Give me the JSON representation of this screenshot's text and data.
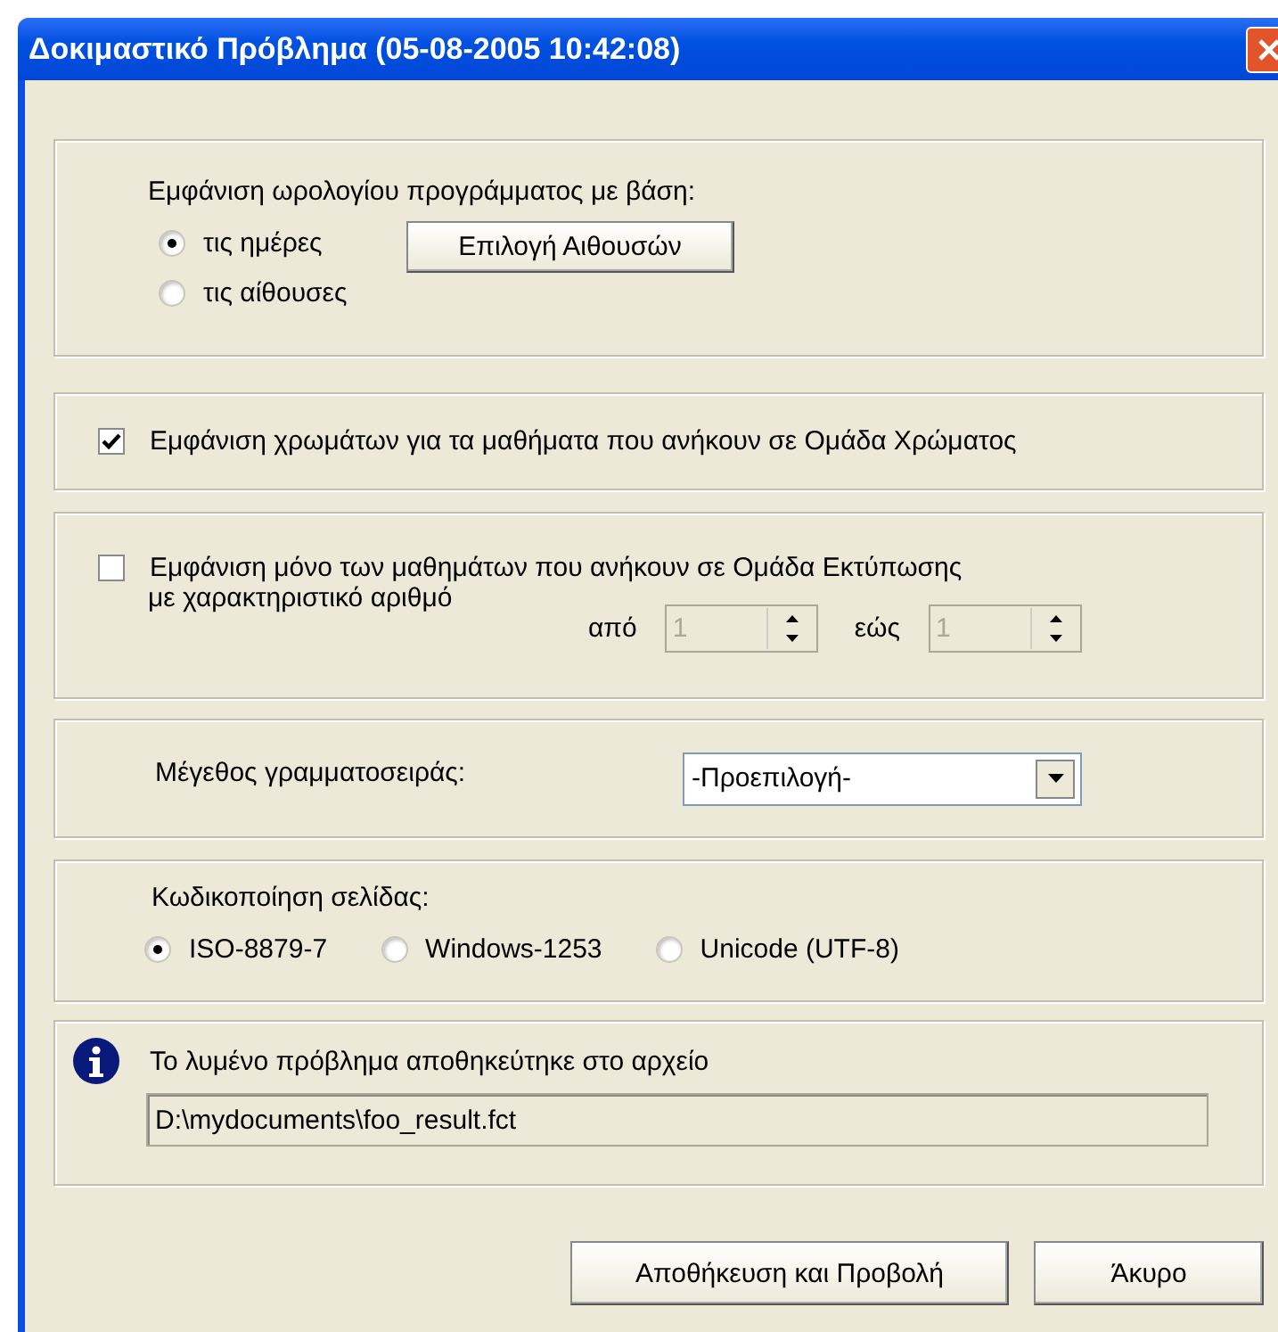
{
  "window": {
    "title": "Δοκιμαστικό Πρόβλημα (05-08-2005 10:42:08)"
  },
  "schedule": {
    "label": "Εμφάνιση ωρολογίου προγράμματος με βάση:",
    "options": [
      {
        "label": "τις ημέρες",
        "selected": true
      },
      {
        "label": "τις αίθουσες",
        "selected": false
      }
    ],
    "button": "Επιλογή Αιθουσών"
  },
  "colors": {
    "label": "Εμφάνιση χρωμάτων για τα μαθήματα που ανήκουν σε Ομάδα Χρώματος",
    "checked": true
  },
  "print_group": {
    "label": "Εμφάνιση μόνο των μαθημάτων που ανήκουν σε Ομάδα  Εκτύπωσης",
    "sublabel": "με χαρακτηριστικό αριθμό",
    "checked": false,
    "range": [
      {
        "label": "από",
        "value": "1",
        "disabled": true
      },
      {
        "label": "εώς",
        "value": "1",
        "disabled": true
      }
    ]
  },
  "font_size": {
    "label": "Μέγεθος γραμματοσειράς:",
    "value": "-Προεπιλογή-"
  },
  "encoding": {
    "label": "Κωδικοποίηση σελίδας:",
    "options": [
      {
        "label": "ISO-8879-7",
        "selected": true
      },
      {
        "label": "Windows-1253",
        "selected": false
      },
      {
        "label": "Unicode (UTF-8)",
        "selected": false
      }
    ]
  },
  "result": {
    "message": "Το λυμένο πρόβλημα αποθηκεύτηκε στο αρχείο",
    "path": "D:\\mydocuments\\foo_result.fct"
  },
  "buttons": [
    "Αποθήκευση και Προβολή",
    "Άκυρο"
  ]
}
